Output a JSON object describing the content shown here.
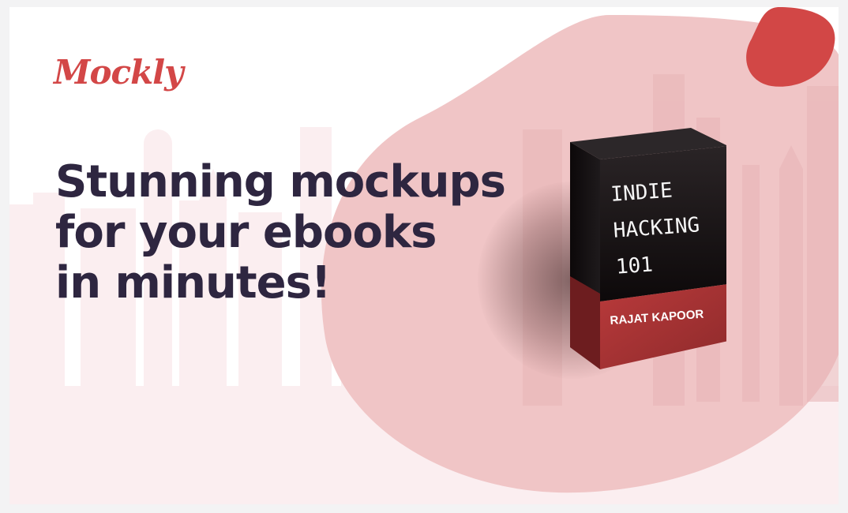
{
  "brand": {
    "logo_text": "Mockly"
  },
  "hero": {
    "headline_lines": [
      "Stunning mockups",
      "for your ebooks",
      "in minutes!"
    ]
  },
  "ebook_box": {
    "title_lines": [
      "INDIE",
      "HACKING",
      "101"
    ],
    "author": "RAJAT KAPOOR"
  },
  "colors": {
    "brand_red": "#d34747",
    "headline": "#2e2640",
    "blob_pink": "#f0c6c6",
    "box_dark": "#1a1416",
    "box_red": "#9b2f30"
  }
}
